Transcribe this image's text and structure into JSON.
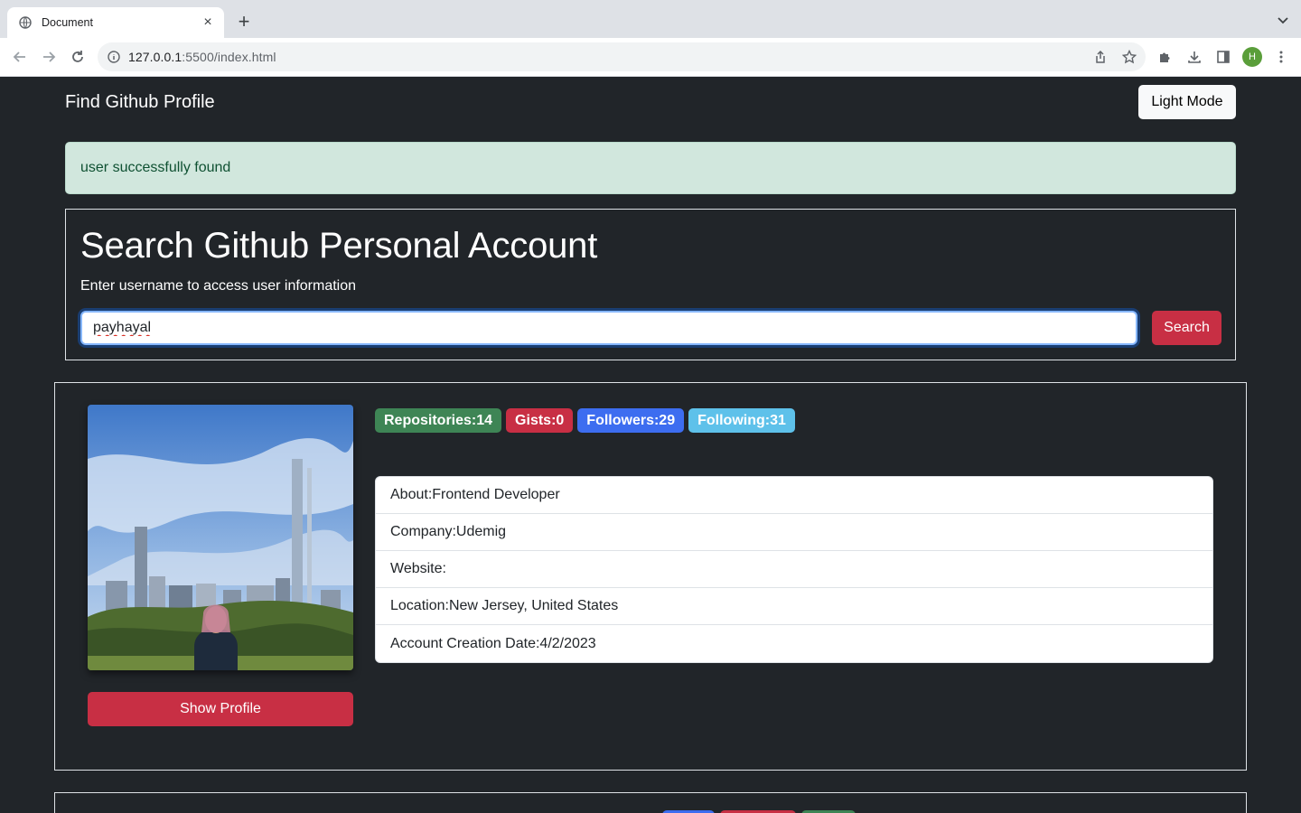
{
  "browser": {
    "tab_title": "Document",
    "url_host": "127.0.0.1",
    "url_rest": ":5500/index.html",
    "profile_initial": "H"
  },
  "navbar": {
    "brand": "Find Github Profile",
    "mode_button": "Light Mode"
  },
  "alert": {
    "message": "user successfully found"
  },
  "search": {
    "heading": "Search Github Personal Account",
    "subtitle": "Enter username to access user information",
    "input_value": "payhayal",
    "button_label": "Search"
  },
  "profile": {
    "show_profile_label": "Show Profile",
    "badges": {
      "repositories": "Repositories:14",
      "gists": "Gists:0",
      "followers": "Followers:29",
      "following": "Following:31"
    },
    "info": {
      "about": "About:Frontend Developer",
      "company": "Company:Udemig",
      "website": "Website:",
      "location": "Location:New Jersey, United States",
      "created": "Account Creation Date:4/2/2023"
    }
  },
  "colors": {
    "page_bg": "#212529",
    "danger": "#c82f44",
    "success_badge": "#3e8555",
    "primary_badge": "#3d6df0",
    "info_badge": "#5ec1ea",
    "alert_bg": "#d1e7dd"
  }
}
